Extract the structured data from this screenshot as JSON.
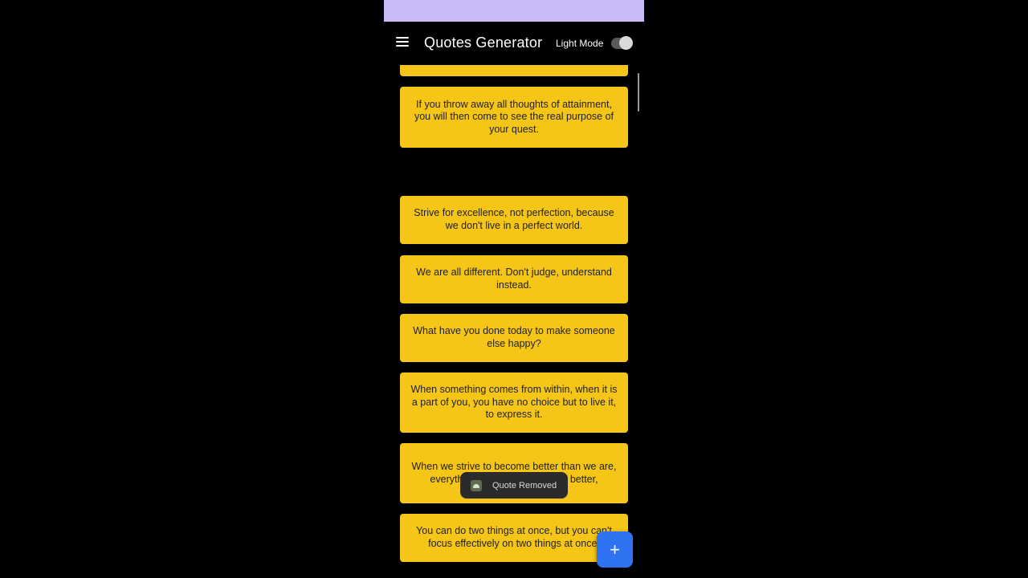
{
  "app": {
    "title": "Quotes Generator",
    "mode_label": "Light Mode"
  },
  "quotes": [
    {
      "text": ""
    },
    {
      "text": "If you throw away all thoughts of attainment, you will then come to see the real purpose of your quest."
    },
    {
      "text": "Strive for excellence, not perfection, because we don't live in a perfect world."
    },
    {
      "text": "We are all different. Don't judge, understand instead."
    },
    {
      "text": "What have you done today to make someone else happy?"
    },
    {
      "text": "When something comes from within, when it is a part of you, you have no choice but to live it, to express it."
    },
    {
      "text": "When we strive to become better than we are, everything around us becomes better,"
    },
    {
      "text": "You can do two things at once, but you can't focus effectively on two things at once."
    }
  ],
  "toast": {
    "text": "Quote Removed"
  },
  "fab": {
    "label": "+"
  },
  "colors": {
    "status_bar": "#c9b9f7",
    "card": "#f5c518",
    "fab": "#2f73f3",
    "background": "#000000"
  }
}
